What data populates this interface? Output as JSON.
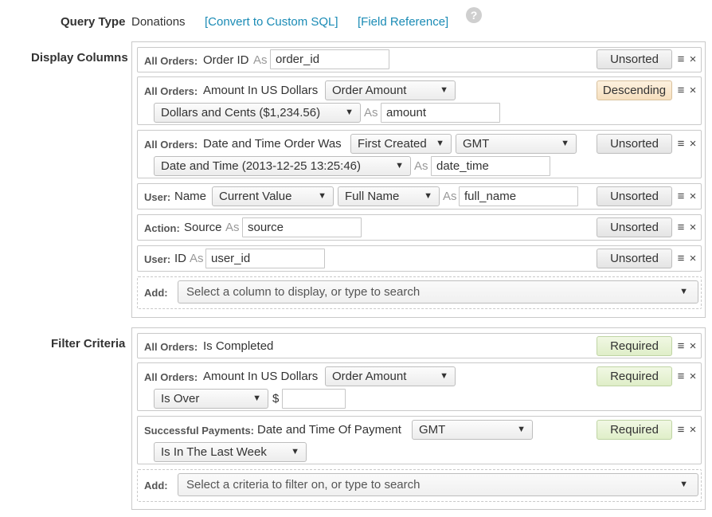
{
  "header": {
    "query_type_label": "Query Type",
    "query_type_value": "Donations",
    "convert_link": "[Convert to Custom SQL]",
    "field_ref_link": "[Field Reference]",
    "help": "?"
  },
  "display": {
    "section_label": "Display Columns",
    "as": "As",
    "rows": [
      {
        "prefix": "All Orders:",
        "field": "Order ID",
        "alias": "order_id",
        "sort": "Unsorted"
      },
      {
        "prefix": "All Orders:",
        "field": "Amount In US Dollars",
        "select1": "Order Amount",
        "select2": "Dollars and Cents ($1,234.56)",
        "alias": "amount",
        "sort": "Descending"
      },
      {
        "prefix": "All Orders:",
        "field": "Date and Time Order Was",
        "select1": "First Created",
        "select_tz": "GMT",
        "select2": "Date and Time (2013-12-25 13:25:46)",
        "alias": "date_time",
        "sort": "Unsorted"
      },
      {
        "prefix": "User:",
        "field": "Name",
        "select1": "Current Value",
        "select2": "Full Name",
        "alias": "full_name",
        "sort": "Unsorted"
      },
      {
        "prefix": "Action:",
        "field": "Source",
        "alias": "source",
        "sort": "Unsorted"
      },
      {
        "prefix": "User:",
        "field": "ID",
        "alias": "user_id",
        "sort": "Unsorted"
      }
    ],
    "add_label": "Add:",
    "add_placeholder": "Select a column to display, or type to search"
  },
  "filter": {
    "section_label": "Filter Criteria",
    "rows": [
      {
        "prefix": "All Orders:",
        "field": "Is Completed",
        "status": "Required"
      },
      {
        "prefix": "All Orders:",
        "field": "Amount In US Dollars",
        "select1": "Order Amount",
        "operator": "Is Over",
        "currency": "$",
        "value": "",
        "status": "Required"
      },
      {
        "prefix": "Successful Payments:",
        "field": "Date and Time Of Payment",
        "select_tz": "GMT",
        "operator": "Is In The Last Week",
        "status": "Required"
      }
    ],
    "add_label": "Add:",
    "add_placeholder": "Select a criteria to filter on, or type to search"
  },
  "icons": {
    "drag": "≡",
    "remove": "×",
    "caret": "▼"
  }
}
